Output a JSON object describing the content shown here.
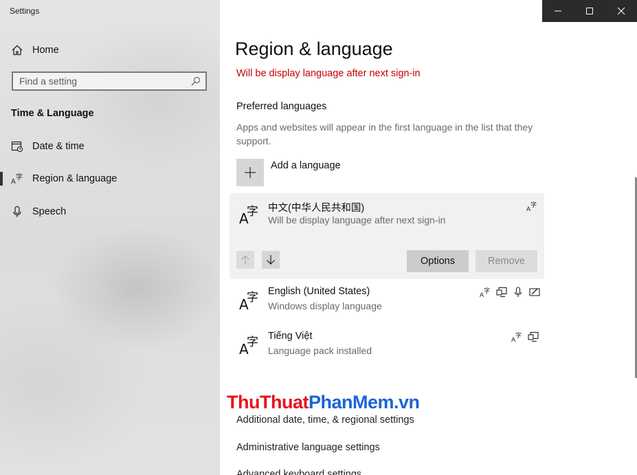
{
  "window": {
    "app_title": "Settings"
  },
  "caption_buttons": {
    "minimize": "minimize-icon",
    "maximize": "maximize-icon",
    "close": "close-icon"
  },
  "nav": {
    "home_label": "Home",
    "search_placeholder": "Find a setting",
    "section_title": "Time & Language",
    "items": [
      {
        "label": "Date & time",
        "icon": "calendar-clock-icon"
      },
      {
        "label": "Region & language",
        "icon": "language-icon",
        "selected": true
      },
      {
        "label": "Speech",
        "icon": "microphone-icon"
      }
    ]
  },
  "main": {
    "title": "Region & language",
    "warning": "Will be display language after next sign-in",
    "preferred_heading": "Preferred languages",
    "preferred_desc": "Apps and websites will appear in the first language in the list that they support.",
    "add_language_label": "Add a language",
    "languages": [
      {
        "name": "中文(中华人民共和国)",
        "status": "Will be display language after next sign-in",
        "features": [
          "language-pack-icon"
        ],
        "selected": true
      },
      {
        "name": "English (United States)",
        "status": "Windows display language",
        "features": [
          "language-pack-icon",
          "display-language-icon",
          "speech-icon",
          "handwriting-icon"
        ]
      },
      {
        "name": "Tiếng Việt",
        "status": "Language pack installed",
        "features": [
          "language-pack-icon",
          "display-language-icon"
        ]
      }
    ],
    "options_label": "Options",
    "remove_label": "Remove",
    "related_links": [
      "Additional date, time, & regional settings",
      "Administrative language settings",
      "Advanced keyboard settings"
    ]
  },
  "watermark": {
    "part1": "Thu",
    "part2": "Thuat",
    "part3": "Phan",
    "part4": "Mem",
    "part5": ".vn"
  },
  "colors": {
    "accent_warning": "#c80000",
    "nav_bg": "#e0e0e0",
    "selected_item_bg": "#f1f1f1",
    "caption_bg": "#2b2b2b"
  }
}
